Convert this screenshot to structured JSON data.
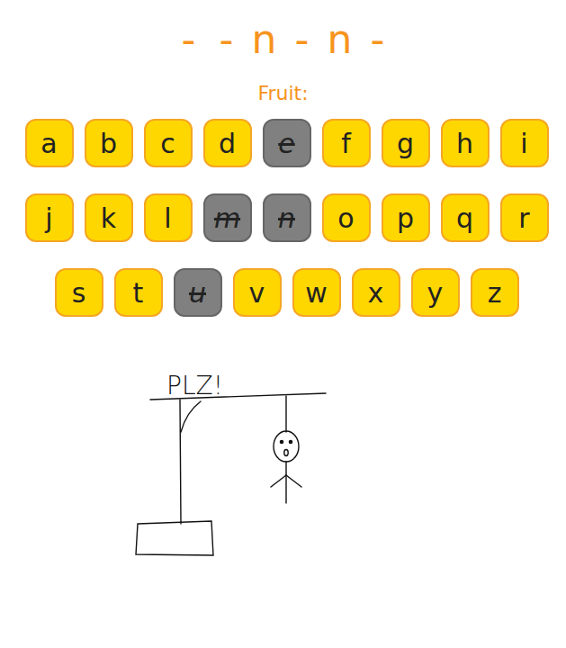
{
  "word": {
    "slots": [
      "-",
      "-",
      "n",
      "-",
      "n",
      "-"
    ]
  },
  "hint": "Fruit:",
  "keys": [
    {
      "letter": "a",
      "used": false
    },
    {
      "letter": "b",
      "used": false
    },
    {
      "letter": "c",
      "used": false
    },
    {
      "letter": "d",
      "used": false
    },
    {
      "letter": "e",
      "used": true
    },
    {
      "letter": "f",
      "used": false
    },
    {
      "letter": "g",
      "used": false
    },
    {
      "letter": "h",
      "used": false
    },
    {
      "letter": "i",
      "used": false
    },
    {
      "letter": "j",
      "used": false
    },
    {
      "letter": "k",
      "used": false
    },
    {
      "letter": "l",
      "used": false
    },
    {
      "letter": "m",
      "used": true
    },
    {
      "letter": "n",
      "used": true
    },
    {
      "letter": "o",
      "used": false
    },
    {
      "letter": "p",
      "used": false
    },
    {
      "letter": "q",
      "used": false
    },
    {
      "letter": "r",
      "used": false
    },
    {
      "letter": "s",
      "used": false
    },
    {
      "letter": "t",
      "used": false
    },
    {
      "letter": "u",
      "used": true
    },
    {
      "letter": "v",
      "used": false
    },
    {
      "letter": "w",
      "used": false
    },
    {
      "letter": "x",
      "used": false
    },
    {
      "letter": "y",
      "used": false
    },
    {
      "letter": "z",
      "used": false
    }
  ],
  "gallows": {
    "sign": "PLZ!"
  },
  "figure": {
    "head": true,
    "body": true,
    "left_arm": true,
    "right_arm": true,
    "left_leg": false,
    "right_leg": false
  }
}
